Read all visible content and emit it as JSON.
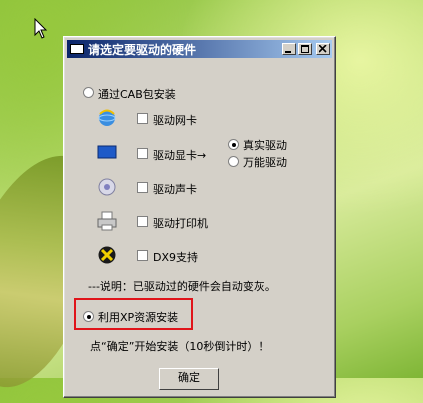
{
  "dialog": {
    "title": "请选定要驱动的硬件",
    "option_cab": "通过CAB包安装",
    "hardware": [
      {
        "label": "驱动网卡",
        "icon": "network-globe-icon"
      },
      {
        "label": "驱动显卡→",
        "icon": "monitor-icon"
      },
      {
        "label": "驱动声卡",
        "icon": "cd-speaker-icon"
      },
      {
        "label": "驱动打印机",
        "icon": "printer-icon"
      },
      {
        "label": "DX9支持",
        "icon": "directx-icon"
      }
    ],
    "display_modes": [
      "真实驱动",
      "万能驱动"
    ],
    "note": "---说明：已驱动过的硬件会自动变灰。",
    "option_xp": "利用XP资源安装",
    "hint": "点“确定”开始安装（10秒倒计时）！",
    "ok_label": "确定"
  },
  "colors": {
    "titlebar": "#0a246a",
    "highlight": "#e0141a",
    "window": "#d4d0c8"
  }
}
